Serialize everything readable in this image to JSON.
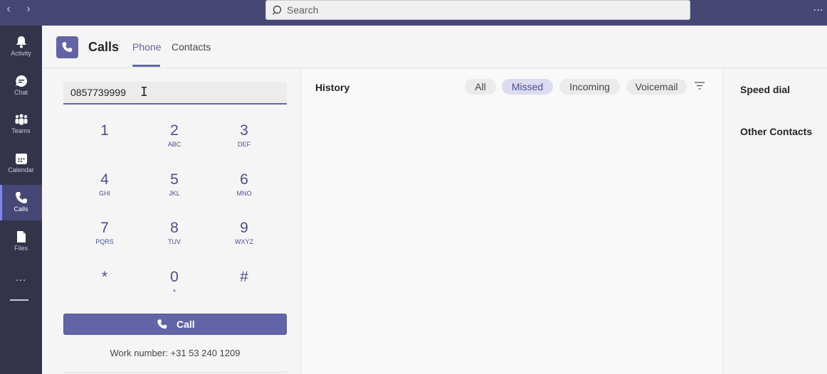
{
  "topbar": {
    "back_icon": "chevron-left-icon",
    "forward_icon": "chevron-right-icon",
    "search_placeholder": "Search",
    "more_label": "…"
  },
  "rail": {
    "items": [
      {
        "label": "Activity",
        "icon": "bell-icon"
      },
      {
        "label": "Chat",
        "icon": "chat-icon"
      },
      {
        "label": "Teams",
        "icon": "teams-icon"
      },
      {
        "label": "Calendar",
        "icon": "calendar-icon"
      },
      {
        "label": "Calls",
        "icon": "phone-icon",
        "active": true
      },
      {
        "label": "Files",
        "icon": "file-icon"
      }
    ],
    "more_label": "…"
  },
  "header": {
    "title": "Calls",
    "tabs": [
      {
        "label": "Phone",
        "active": true
      },
      {
        "label": "Contacts",
        "active": false
      }
    ]
  },
  "dialpad": {
    "input_value": "0857739999",
    "keys": [
      {
        "digit": "1",
        "letters": ""
      },
      {
        "digit": "2",
        "letters": "ABC"
      },
      {
        "digit": "3",
        "letters": "DEF"
      },
      {
        "digit": "4",
        "letters": "GHI"
      },
      {
        "digit": "5",
        "letters": "JKL"
      },
      {
        "digit": "6",
        "letters": "MNO"
      },
      {
        "digit": "7",
        "letters": "PQRS"
      },
      {
        "digit": "8",
        "letters": "TUV"
      },
      {
        "digit": "9",
        "letters": "WXYZ"
      },
      {
        "digit": "*",
        "letters": ""
      },
      {
        "digit": "0",
        "letters": "+"
      },
      {
        "digit": "#",
        "letters": ""
      }
    ],
    "call_label": "Call",
    "work_number": "Work number: +31 53 240 1209"
  },
  "history": {
    "title": "History",
    "filters": [
      {
        "label": "All",
        "active": false
      },
      {
        "label": "Missed",
        "active": true
      },
      {
        "label": "Incoming",
        "active": false
      },
      {
        "label": "Voicemail",
        "active": false
      }
    ]
  },
  "right_panel": {
    "speed_dial": "Speed dial",
    "other_contacts": "Other Contacts"
  },
  "colors": {
    "accent": "#6264a7",
    "topbar": "#464775",
    "rail": "#33344a"
  }
}
